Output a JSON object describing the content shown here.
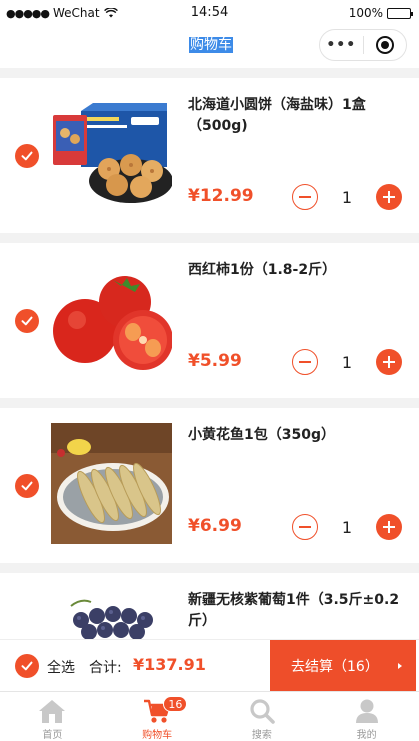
{
  "status_bar": {
    "carrier": "WeChat",
    "signal_dots": "●●●●●",
    "time": "14:54",
    "battery": "100%"
  },
  "nav": {
    "title": "购物车",
    "more_label": "•••"
  },
  "currency": "¥",
  "items": [
    {
      "title": "北海道小圆饼（海盐味）1盒（500g)",
      "price": "¥12.99",
      "qty": "1",
      "checked": true,
      "image": "biscuit-box-image"
    },
    {
      "title": "西红柿1份（1.8-2斤）",
      "price": "¥5.99",
      "qty": "1",
      "checked": true,
      "image": "tomato-image"
    },
    {
      "title": "小黄花鱼1包（350g）",
      "price": "¥6.99",
      "qty": "1",
      "checked": true,
      "image": "yellow-croaker-image"
    },
    {
      "title": "新疆无核紫葡萄1件（3.5斤±0.2斤）",
      "price": "",
      "qty": "",
      "checked": true,
      "image": "grape-image"
    }
  ],
  "checkout": {
    "select_all_label": "全选",
    "total_label": "合计:",
    "total_value": "¥137.91",
    "pay_label": "去结算（16）"
  },
  "tabbar": {
    "tabs": [
      {
        "label": "首页",
        "icon": "home-icon",
        "active": false
      },
      {
        "label": "购物车",
        "icon": "cart-icon",
        "active": true,
        "badge": "16"
      },
      {
        "label": "搜索",
        "icon": "search-icon",
        "active": false
      },
      {
        "label": "我的",
        "icon": "person-icon",
        "active": false
      }
    ]
  },
  "colors": {
    "accent": "#f0502a",
    "inactive": "#c8c8c8",
    "background": "#f2f2f2"
  }
}
